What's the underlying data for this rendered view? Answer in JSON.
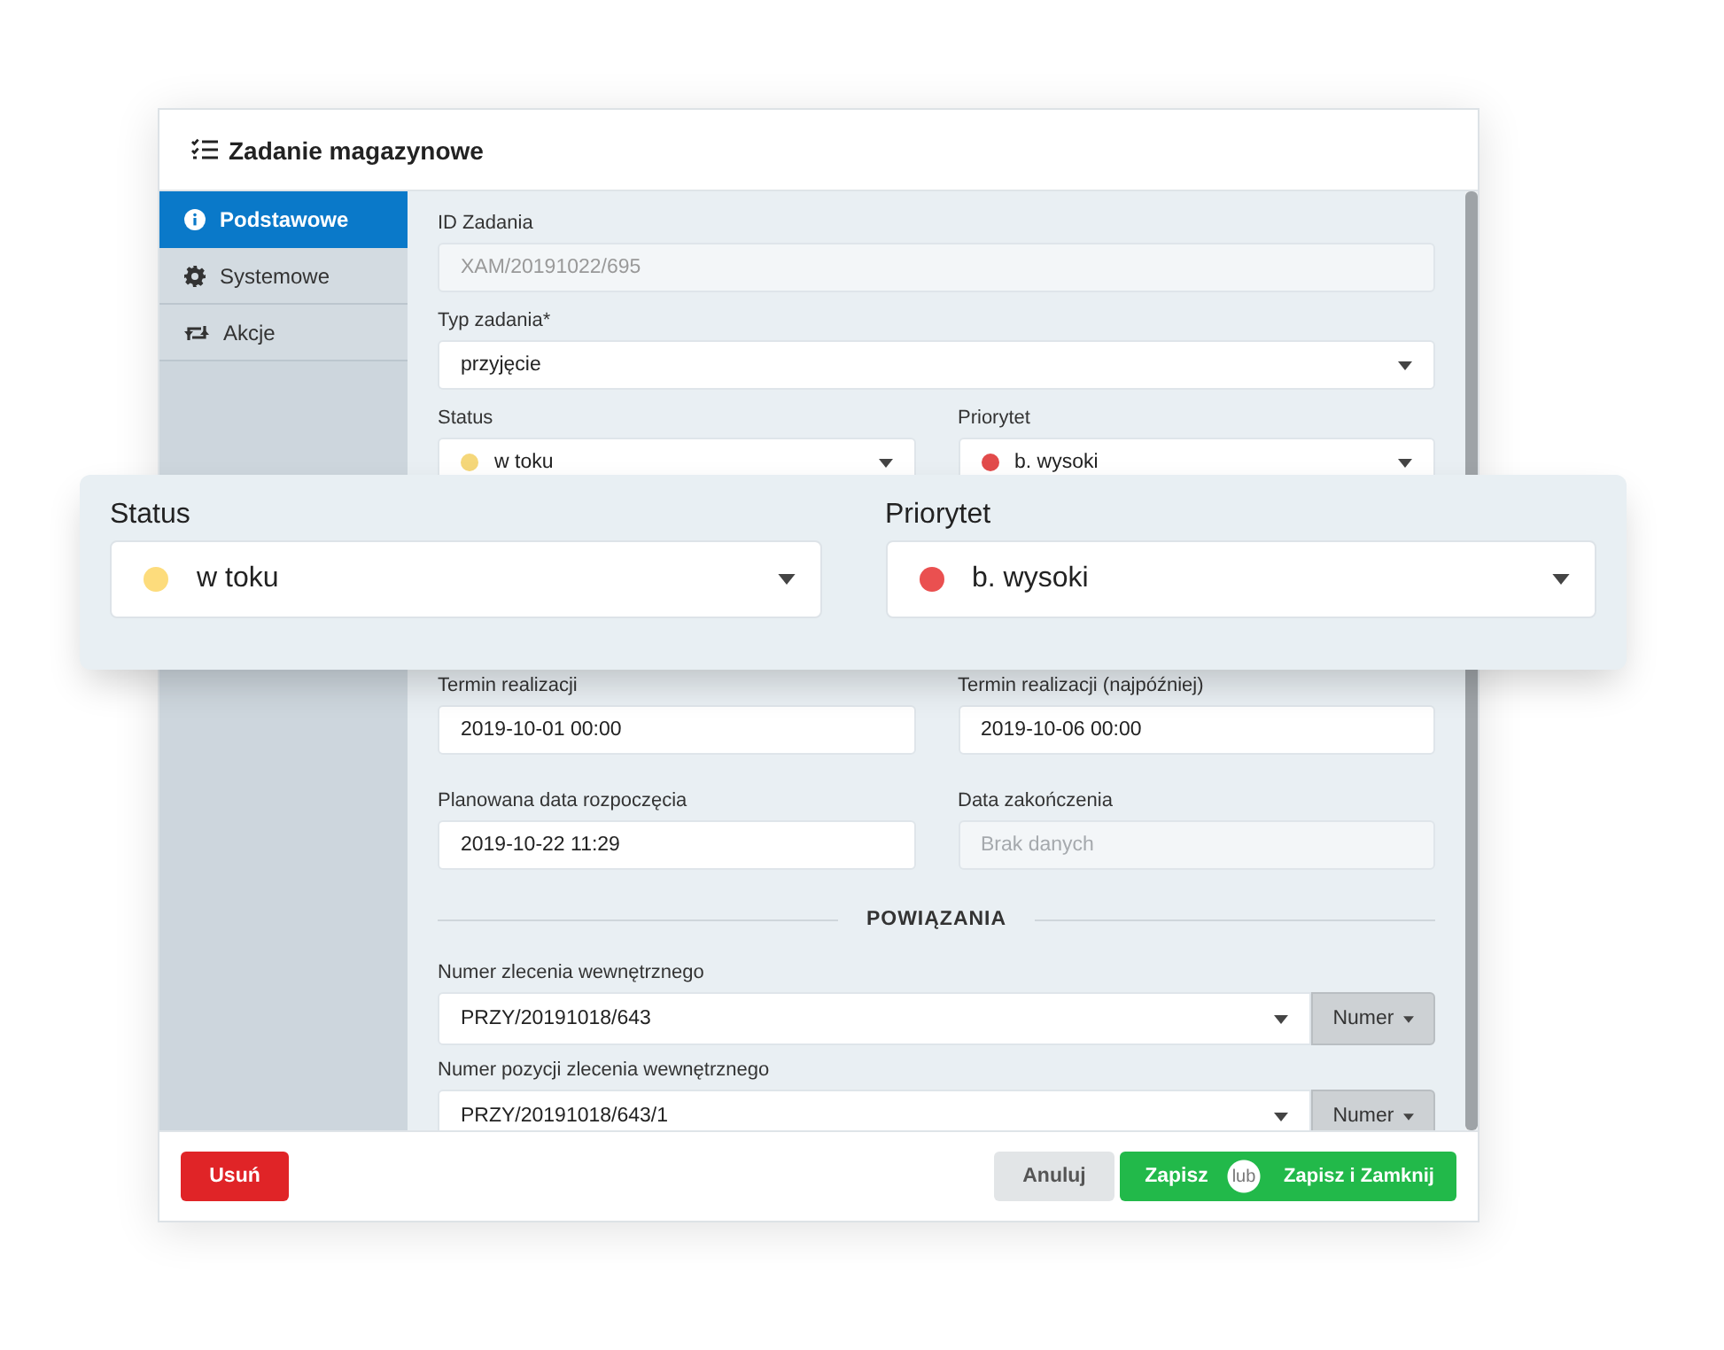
{
  "window": {
    "title": "Zadanie magazynowe"
  },
  "sidebar": {
    "items": [
      {
        "label": "Podstawowe",
        "kind": "info",
        "selected": true
      },
      {
        "label": "Systemowe",
        "kind": "gear",
        "selected": false
      },
      {
        "label": "Akcje",
        "kind": "repeat",
        "selected": false
      }
    ]
  },
  "form": {
    "upper_rows": [
      [
        {
          "kind": "readonly",
          "label": "ID Zadania",
          "value": "XAM/20191022/695"
        }
      ],
      [
        {
          "kind": "select",
          "label": "Typ zadania*",
          "value": "przyjęcie"
        }
      ],
      [
        {
          "kind": "dot-select",
          "label": "Status",
          "value": "w toku",
          "color": "#f5d77a"
        },
        {
          "kind": "dot-select",
          "label": "Priorytet",
          "value": "b. wysoki",
          "color": "#e24b4b"
        }
      ]
    ],
    "lower_rows": [
      [
        {
          "kind": "input",
          "label": "Termin realizacji",
          "value": "2019-10-01 00:00"
        },
        {
          "kind": "input",
          "label": "Termin realizacji (najpóźniej)",
          "value": "2019-10-06 00:00"
        }
      ],
      [
        {
          "kind": "input",
          "label": "Planowana data rozpoczęcia",
          "value": "2019-10-22 11:29"
        },
        {
          "kind": "readonly",
          "label": "Data zakończenia",
          "placeholder": "Brak danych"
        }
      ]
    ],
    "section": "POWIĄZANIA",
    "link_rows": [
      [
        {
          "kind": "lookup",
          "label": "Numer zlecenia wewnętrznego",
          "value": "PRZY/20191018/643",
          "button": "Numer"
        }
      ],
      [
        {
          "kind": "lookup",
          "label": "Numer pozycji zlecenia wewnętrznego",
          "value": "PRZY/20191018/643/1",
          "button": "Numer"
        }
      ]
    ]
  },
  "magnifier": {
    "fields": [
      {
        "label": "Status",
        "value": "w toku",
        "color": "#fddc7c"
      },
      {
        "label": "Priorytet",
        "value": "b. wysoki",
        "color": "#ea5050"
      }
    ]
  },
  "footer": {
    "delete": "Usuń",
    "cancel": "Anuluj",
    "save": "Zapisz",
    "or": "lub",
    "save_close": "Zapisz i Zamknij"
  }
}
